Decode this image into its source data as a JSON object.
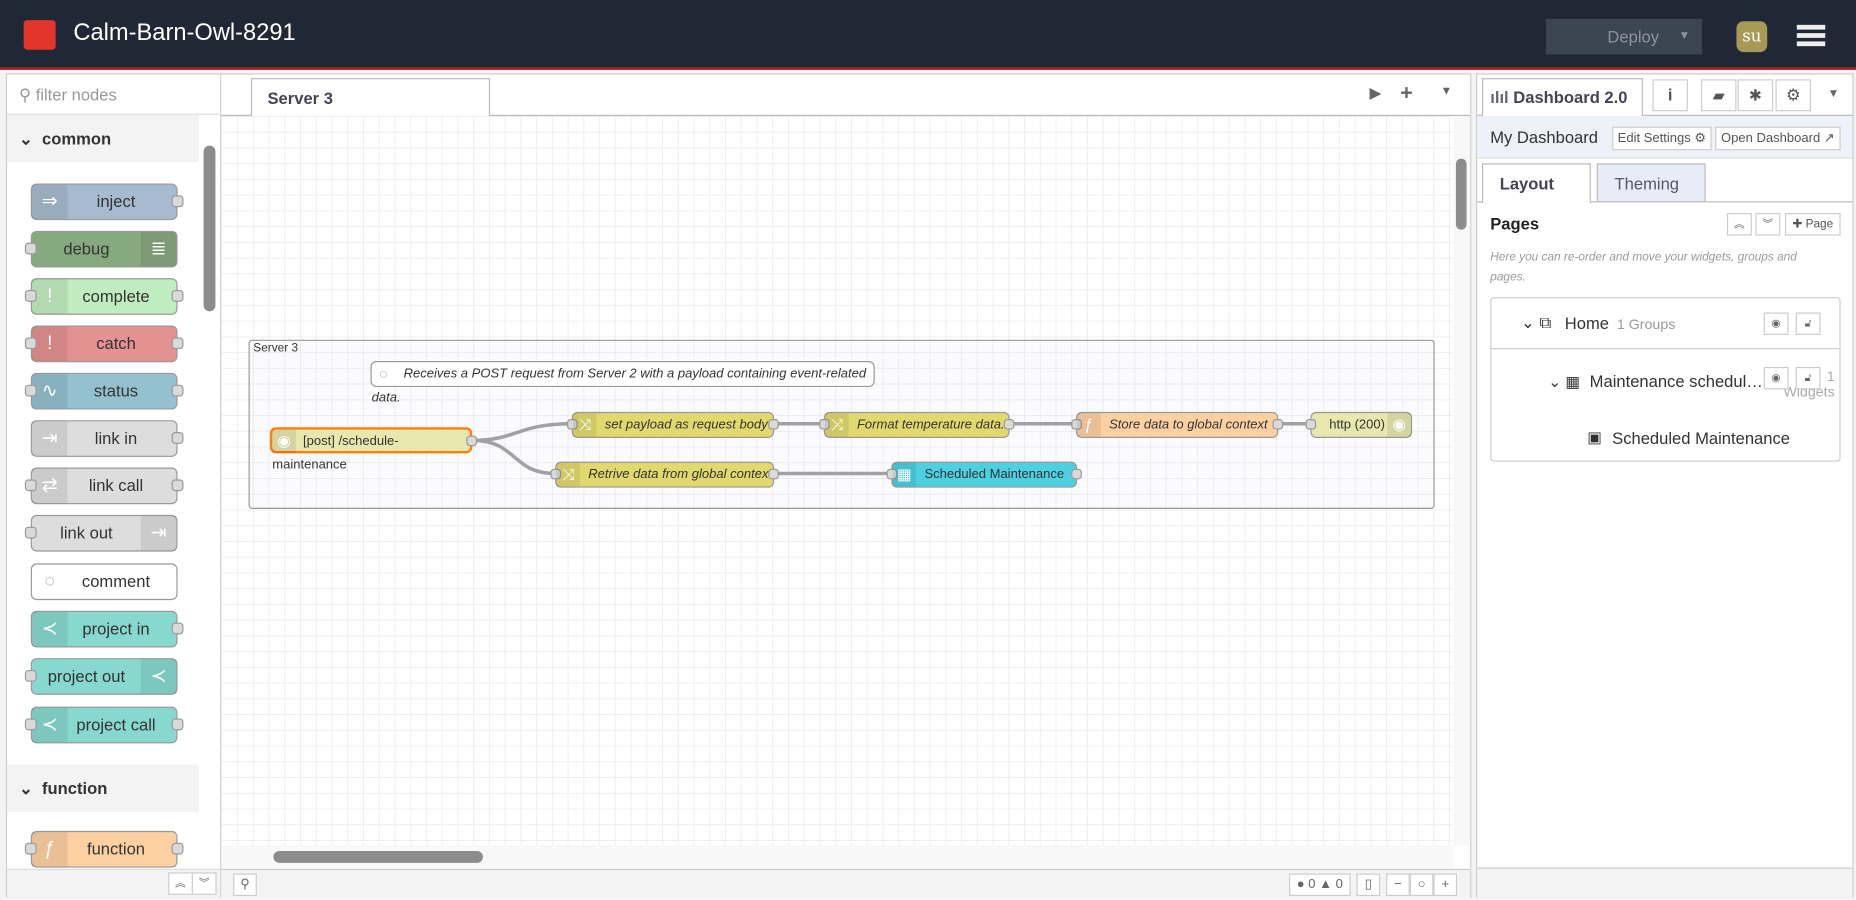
{
  "header": {
    "title": "Calm-Barn-Owl-8291",
    "deploy_label": "Deploy",
    "avatar": "su"
  },
  "palette": {
    "filter_placeholder": "filter nodes",
    "categories": [
      "common",
      "function"
    ],
    "nodes": [
      {
        "label": "inject",
        "color": "#a6bbcf"
      },
      {
        "label": "debug",
        "color": "#87a980"
      },
      {
        "label": "complete",
        "color": "#c0edc0"
      },
      {
        "label": "catch",
        "color": "#e49191"
      },
      {
        "label": "status",
        "color": "#94c1d0"
      },
      {
        "label": "link in",
        "color": "#dddddd"
      },
      {
        "label": "link call",
        "color": "#dddddd"
      },
      {
        "label": "link out",
        "color": "#dddddd"
      },
      {
        "label": "comment",
        "color": "#ffffff"
      },
      {
        "label": "project in",
        "color": "#87d8cf"
      },
      {
        "label": "project out",
        "color": "#87d8cf"
      },
      {
        "label": "project call",
        "color": "#87d8cf"
      },
      {
        "label": "function",
        "color": "#fdd0a2"
      }
    ]
  },
  "workspace": {
    "tab": "Server 3",
    "group": "Server 3",
    "comment": "Receives a POST request from Server 2 with a payload containing event-related data.",
    "flow": {
      "http_in": "[post] /schedule-maintenance",
      "set_payload": "set payload as request body",
      "format": "Format temperature data.",
      "store": "Store data to global context",
      "http_response": "http (200)",
      "retrieve": "Retrive data from global context",
      "table": "Scheduled Maintenance"
    },
    "footer": {
      "errors": "0",
      "warnings": "0"
    }
  },
  "sidebar": {
    "tab": "Dashboard 2.0",
    "dashboard_name": "My Dashboard",
    "edit_settings": "Edit Settings",
    "open_dashboard": "Open Dashboard",
    "layout_tab": "Layout",
    "theming_tab": "Theming",
    "pages_title": "Pages",
    "add_page": "Page",
    "hint": "Here you can re-order and move your widgets, groups and pages.",
    "tree": {
      "page": "Home",
      "page_count": "1 Groups",
      "group": "Maintenance schedul…",
      "group_count": "1 Widgets",
      "widget": "Scheduled Maintenance"
    }
  }
}
